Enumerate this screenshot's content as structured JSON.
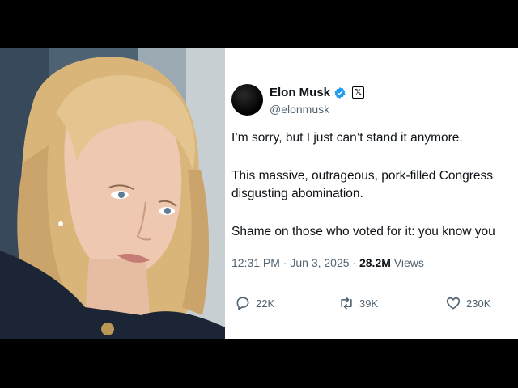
{
  "tweet": {
    "display_name": "Elon Musk",
    "handle": "@elonmusk",
    "paragraphs": [
      "I’m sorry, but I just can’t stand it anymore.",
      "This massive, outrageous, pork-filled Congress",
      "disgusting abomination.",
      "Shame on those who voted for it: you know you"
    ],
    "time": "12:31 PM · Jun 3, 2025 · ",
    "views_count": "28.2M",
    "views_label": " Views",
    "replies": "22K",
    "reposts": "39K",
    "likes": "230K"
  },
  "colors": {
    "verified": "#1d9bf0",
    "muted_text": "#536471",
    "main_text": "#0f1419"
  },
  "icons": [
    "verified-badge-icon",
    "x-logo-icon",
    "reply-icon",
    "repost-icon",
    "like-icon"
  ]
}
